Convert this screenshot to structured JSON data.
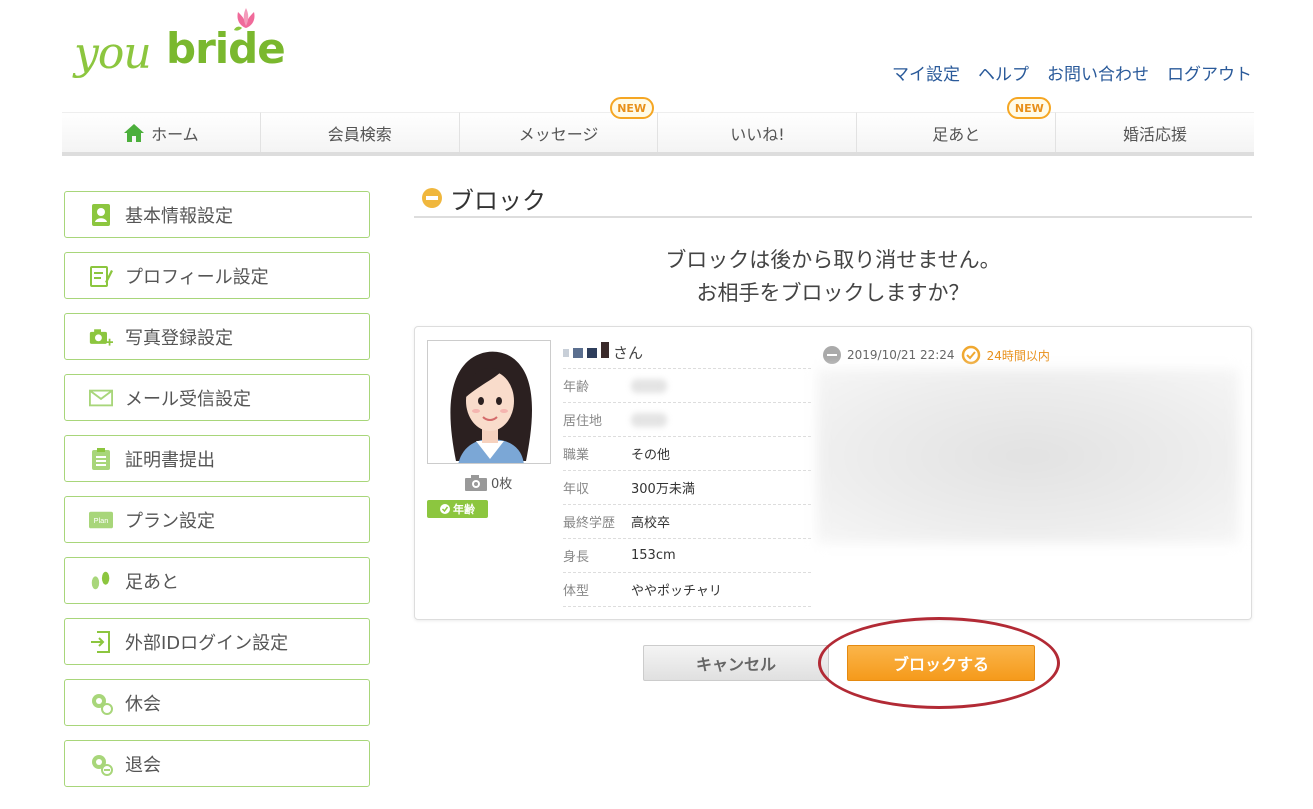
{
  "logo": {
    "part1": "you",
    "part2": "bride"
  },
  "top_links": [
    "マイ設定",
    "ヘルプ",
    "お問い合わせ",
    "ログアウト"
  ],
  "nav": {
    "items": [
      {
        "label": "ホーム",
        "icon": "home-icon"
      },
      {
        "label": "会員検索"
      },
      {
        "label": "メッセージ",
        "badge": "NEW"
      },
      {
        "label": "いいね!"
      },
      {
        "label": "足あと",
        "badge": "NEW"
      },
      {
        "label": "婚活応援"
      }
    ]
  },
  "sidebar": {
    "items": [
      {
        "label": "基本情報設定",
        "icon": "contact-card-icon"
      },
      {
        "label": "プロフィール設定",
        "icon": "edit-note-icon"
      },
      {
        "label": "写真登録設定",
        "icon": "camera-add-icon"
      },
      {
        "label": "メール受信設定",
        "icon": "envelope-icon"
      },
      {
        "label": "証明書提出",
        "icon": "clipboard-icon"
      },
      {
        "label": "プラン設定",
        "icon": "plan-icon",
        "icon_text": "Plan"
      },
      {
        "label": "足あと",
        "icon": "footprints-icon"
      },
      {
        "label": "外部IDログイン設定",
        "icon": "login-arrow-icon"
      },
      {
        "label": "休会",
        "icon": "gear-pause-icon"
      },
      {
        "label": "退会",
        "icon": "gear-remove-icon"
      }
    ]
  },
  "main": {
    "title": "ブロック",
    "message_line1": "ブロックは後から取り消せません。",
    "message_line2": "お相手をブロックしますか？"
  },
  "profile": {
    "name_suffix": "さん",
    "photo_count": "0枚",
    "age_badge": "年齢",
    "rows": [
      {
        "key": "年齢",
        "value": "",
        "blurred": true
      },
      {
        "key": "居住地",
        "value": "",
        "blurred": true
      },
      {
        "key": "職業",
        "value": "その他"
      },
      {
        "key": "年収",
        "value": "300万未満"
      },
      {
        "key": "最終学歴",
        "value": "高校卒"
      },
      {
        "key": "身長",
        "value": "153cm"
      },
      {
        "key": "体型",
        "value": "ややポッチャリ"
      }
    ],
    "last_login": "2019/10/21 22:24",
    "recent_label": "24時間以内"
  },
  "buttons": {
    "cancel": "キャンセル",
    "block": "ブロックする"
  },
  "colors": {
    "brand_green": "#8cc63f",
    "accent_orange": "#f5a623",
    "highlight_red": "#b22a35",
    "link_blue": "#2a5a9a"
  }
}
